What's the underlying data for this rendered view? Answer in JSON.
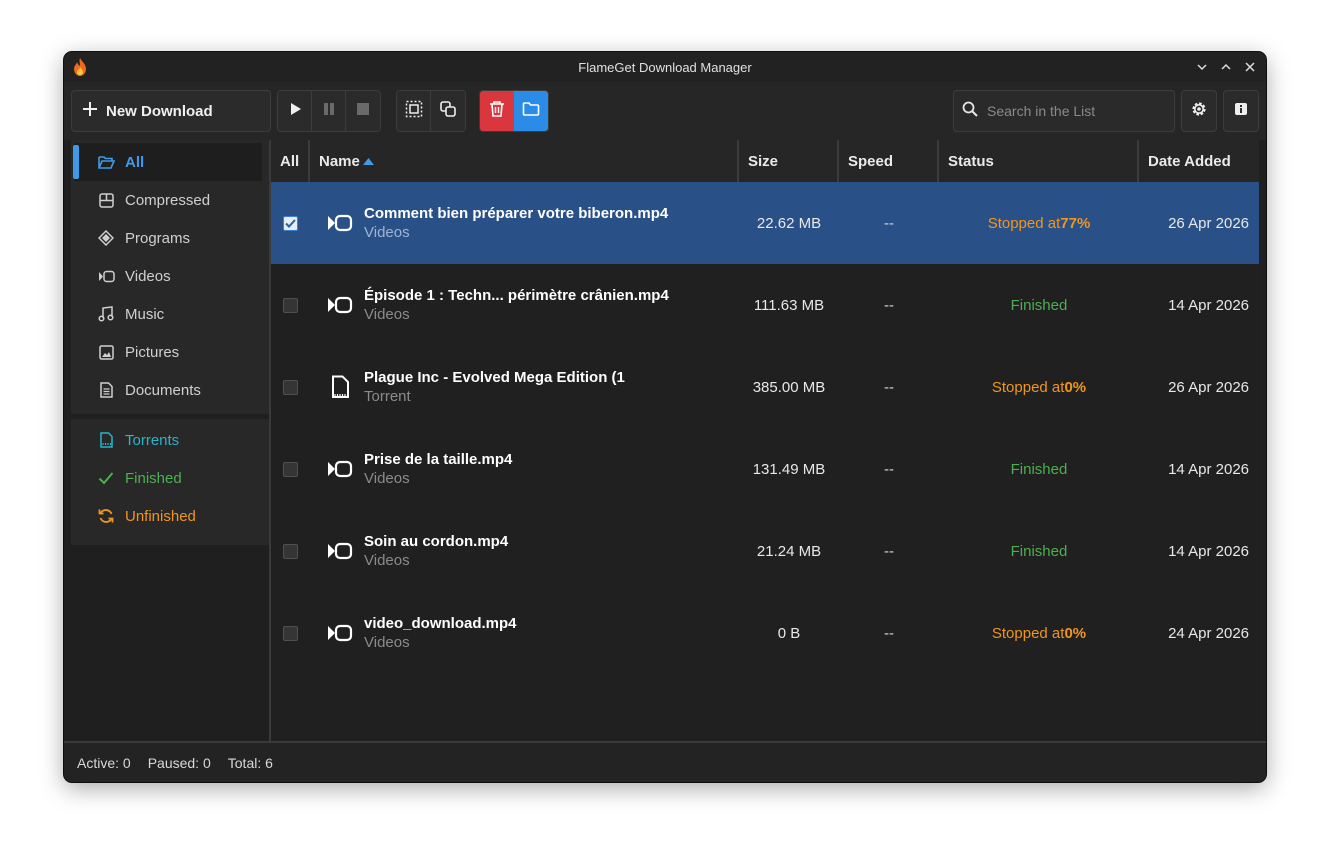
{
  "window": {
    "title": "FlameGet Download Manager",
    "app_icon": "flame-icon"
  },
  "toolbar": {
    "new_download_label": "New Download",
    "search_placeholder": "Search in the List"
  },
  "sidebar": {
    "categories": [
      {
        "label": "All",
        "icon": "folder-open-icon"
      },
      {
        "label": "Compressed",
        "icon": "archive-icon"
      },
      {
        "label": "Programs",
        "icon": "program-icon"
      },
      {
        "label": "Videos",
        "icon": "video-icon"
      },
      {
        "label": "Music",
        "icon": "music-icon"
      },
      {
        "label": "Pictures",
        "icon": "picture-icon"
      },
      {
        "label": "Documents",
        "icon": "document-icon"
      }
    ],
    "statuses": [
      {
        "label": "Torrents",
        "icon": "torrent-icon",
        "color": "#26b5c9"
      },
      {
        "label": "Finished",
        "icon": "check-icon",
        "color": "#4caf50"
      },
      {
        "label": "Unfinished",
        "icon": "refresh-icon",
        "color": "#f0961e"
      }
    ]
  },
  "table": {
    "columns": {
      "all": "All",
      "name": "Name",
      "size": "Size",
      "speed": "Speed",
      "status": "Status",
      "date": "Date Added"
    },
    "rows": [
      {
        "name": "Comment bien préparer votre biberon.mp4",
        "type": "Videos",
        "size": "22.62 MB",
        "speed": "--",
        "status_prefix": "Stopped at ",
        "status_value": "77%",
        "date": "26 Apr 2026",
        "selected": true,
        "checked": true
      },
      {
        "name": "Épisode 1 : Techn... périmètre crânien.mp4",
        "type": "Videos",
        "size": "111.63 MB",
        "speed": "--",
        "status_prefix": "Finished",
        "status_value": "",
        "date": "14 Apr 2026",
        "selected": false,
        "checked": false
      },
      {
        "name": "Plague Inc - Evolved Mega Edition (1",
        "type": "Torrent",
        "size": "385.00 MB",
        "speed": "--",
        "status_prefix": "Stopped at ",
        "status_value": "0%",
        "date": "26 Apr 2026",
        "selected": false,
        "checked": false
      },
      {
        "name": "Prise de la taille.mp4",
        "type": "Videos",
        "size": "131.49 MB",
        "speed": "--",
        "status_prefix": "Finished",
        "status_value": "",
        "date": "14 Apr 2026",
        "selected": false,
        "checked": false
      },
      {
        "name": "Soin au cordon.mp4",
        "type": "Videos",
        "size": "21.24 MB",
        "speed": "--",
        "status_prefix": "Finished",
        "status_value": "",
        "date": "14 Apr 2026",
        "selected": false,
        "checked": false
      },
      {
        "name": "video_download.mp4",
        "type": "Videos",
        "size": "0 B",
        "speed": "--",
        "status_prefix": "Stopped at ",
        "status_value": "0%",
        "date": "24 Apr 2026",
        "selected": false,
        "checked": false
      }
    ]
  },
  "statusbar": {
    "active": "Active: 0",
    "paused": "Paused: 0",
    "total": "Total: 6"
  },
  "colors": {
    "accent": "#3d9be9",
    "selected_row": "#2a5088",
    "delete_button": "#d9363e",
    "open_folder_button": "#2a8ce6",
    "stopped": "#f0961e",
    "finished": "#4caf50"
  }
}
